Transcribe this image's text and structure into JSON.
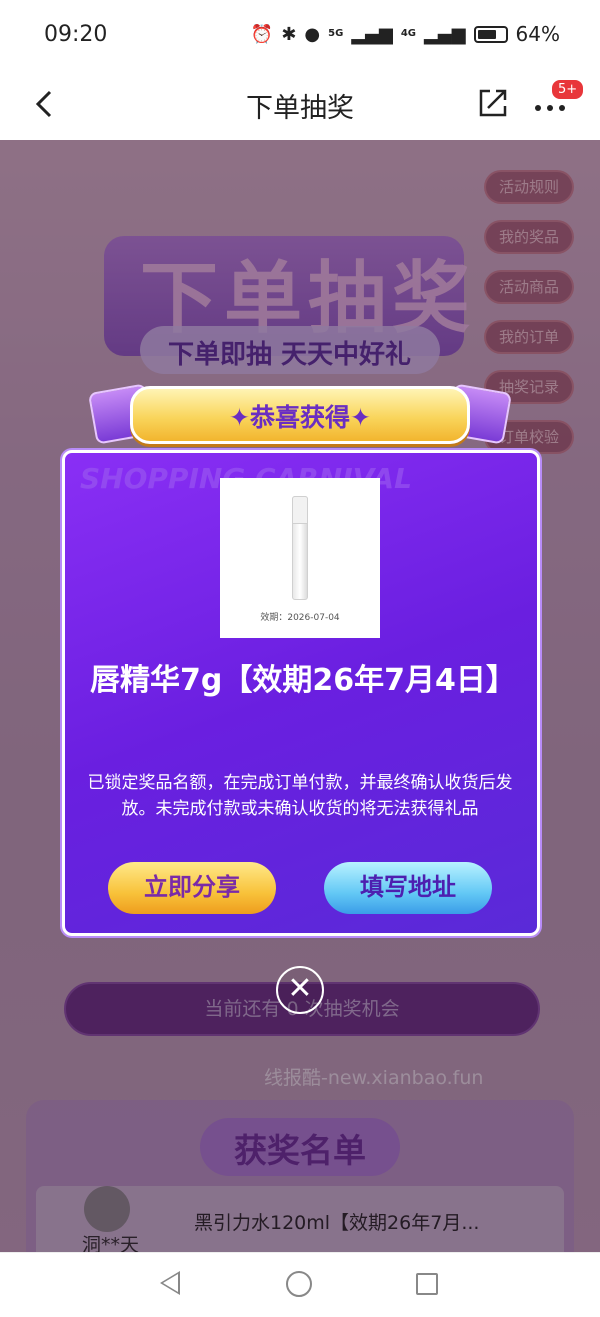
{
  "status_bar": {
    "time": "09:20",
    "battery": "64%",
    "net1": "5G",
    "net2": "4G"
  },
  "nav": {
    "title": "下单抽奖",
    "badge": "5+"
  },
  "background": {
    "title": "下单抽奖",
    "subtitle": "下单即抽 天天中好礼",
    "side_menu": [
      "活动规则",
      "我的奖品",
      "活动商品",
      "我的订单",
      "抽奖记录",
      "订单校验"
    ],
    "chances_text": "当前还有 0 次抽奖机会",
    "decor_text": "SHOPPING CARNIVAL",
    "watermark": "线报酷-new.xianbao.fun",
    "winners": {
      "title": "获奖名单",
      "rows": [
        {
          "name": "洞**天",
          "prize": "黑引力水120ml【效期26年7月..."
        }
      ]
    }
  },
  "modal": {
    "header": "✦恭喜获得✦",
    "prize_expiry": "效期：2026-07-04",
    "prize_name": "唇精华7g【效期26年7月4日】",
    "description": "已锁定奖品名额，在完成订单付款，并最终确认收货后发放。未完成付款或未确认收货的将无法获得礼品",
    "share_button": "立即分享",
    "address_button": "填写地址",
    "close_symbol": "✕"
  }
}
